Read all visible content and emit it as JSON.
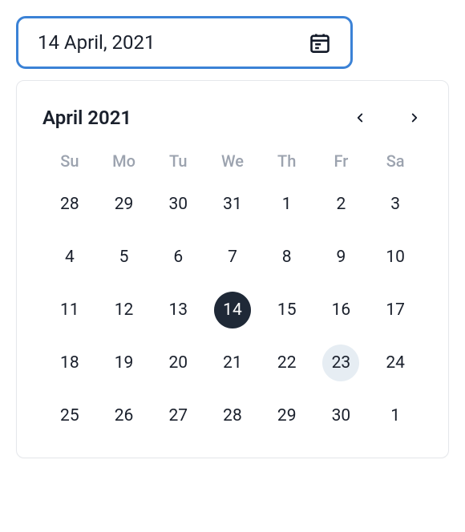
{
  "input": {
    "value": "14 April, 2021"
  },
  "calendar": {
    "month_year": "April 2021",
    "weekdays": [
      "Su",
      "Mo",
      "Tu",
      "We",
      "Th",
      "Fr",
      "Sa"
    ],
    "days": [
      {
        "n": 28,
        "other": true
      },
      {
        "n": 29,
        "other": true
      },
      {
        "n": 30,
        "other": true
      },
      {
        "n": 31,
        "other": true
      },
      {
        "n": 1
      },
      {
        "n": 2
      },
      {
        "n": 3
      },
      {
        "n": 4
      },
      {
        "n": 5
      },
      {
        "n": 6
      },
      {
        "n": 7
      },
      {
        "n": 8
      },
      {
        "n": 9
      },
      {
        "n": 10
      },
      {
        "n": 11
      },
      {
        "n": 12
      },
      {
        "n": 13
      },
      {
        "n": 14,
        "selected": true
      },
      {
        "n": 15
      },
      {
        "n": 16
      },
      {
        "n": 17
      },
      {
        "n": 18
      },
      {
        "n": 19
      },
      {
        "n": 20
      },
      {
        "n": 21
      },
      {
        "n": 22
      },
      {
        "n": 23,
        "highlight": true
      },
      {
        "n": 24
      },
      {
        "n": 25
      },
      {
        "n": 26
      },
      {
        "n": 27
      },
      {
        "n": 28
      },
      {
        "n": 29
      },
      {
        "n": 30
      },
      {
        "n": 1,
        "other": true
      }
    ]
  }
}
